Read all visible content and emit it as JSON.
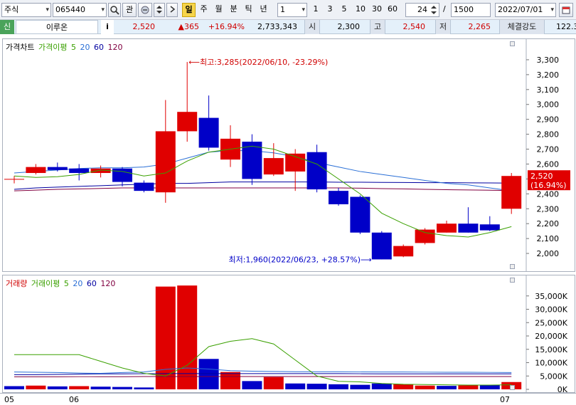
{
  "toolbar": {
    "market_select": "주식",
    "code_input": "065440",
    "search_icon": "magnifier-icon",
    "watch_label": "관",
    "period_buttons": [
      "일",
      "주",
      "월",
      "분",
      "틱",
      "년"
    ],
    "active_period": "일",
    "interval_value": "1",
    "minute_buttons": [
      "1",
      "3",
      "5",
      "10",
      "30",
      "60"
    ],
    "count_value": "24",
    "slash": "/",
    "total_value": "1500",
    "date_value": "2022/07/01"
  },
  "infobar": {
    "tag": "신",
    "stock_name": "이루온",
    "info_label": "i",
    "price": "2,520",
    "change": "▲365",
    "change_pct": "+16.94%",
    "volume": "2,733,343",
    "open_label": "시",
    "open": "2,300",
    "high_label": "고",
    "high": "2,540",
    "low_label": "저",
    "low": "2,265",
    "strength_label": "체결강도",
    "strength": "122.3"
  },
  "price_panel": {
    "legend": {
      "main": "가격차트",
      "ma_label": "가격이평",
      "ma_values": [
        "5",
        "20",
        "60",
        "120"
      ]
    },
    "annotations": {
      "high": "⟵최고:3,285(2022/06/10, -23.29%)",
      "low": "최저:1,960(2022/06/23, +28.57%)⟶"
    },
    "current_label_price": "2,520",
    "current_label_pct": "(16.94%)"
  },
  "volume_panel": {
    "legend": {
      "main": "거래량",
      "ma_label": "거래이평",
      "ma_values": [
        "5",
        "20",
        "60",
        "120"
      ]
    }
  },
  "date_axis": [
    "05",
    "06",
    "07"
  ],
  "colors": {
    "up": "#e00000",
    "down": "#0000c8",
    "ma5": "#3aa000",
    "ma20": "#2a6fd6",
    "ma60": "#0000a0",
    "ma120": "#800040"
  },
  "chart_data": [
    {
      "type": "candlestick",
      "ylim": [
        1900,
        3400
      ],
      "y_ticks": [
        "2,000",
        "2,100",
        "2,200",
        "2,300",
        "2,400",
        "2,500",
        "2,600",
        "2,700",
        "2,800",
        "2,900",
        "3,000",
        "3,100",
        "3,200",
        "3,300"
      ],
      "candles": [
        {
          "o": 2500,
          "h": 2520,
          "l": 2470,
          "c": 2500
        },
        {
          "o": 2540,
          "h": 2600,
          "l": 2530,
          "c": 2580
        },
        {
          "o": 2580,
          "h": 2610,
          "l": 2550,
          "c": 2560
        },
        {
          "o": 2570,
          "h": 2600,
          "l": 2490,
          "c": 2540
        },
        {
          "o": 2540,
          "h": 2590,
          "l": 2510,
          "c": 2570
        },
        {
          "o": 2570,
          "h": 2580,
          "l": 2450,
          "c": 2480
        },
        {
          "o": 2475,
          "h": 2490,
          "l": 2410,
          "c": 2420
        },
        {
          "o": 2410,
          "h": 3030,
          "l": 2340,
          "c": 2820
        },
        {
          "o": 2820,
          "h": 3285,
          "l": 2750,
          "c": 2950
        },
        {
          "o": 2910,
          "h": 3060,
          "l": 2690,
          "c": 2710
        },
        {
          "o": 2630,
          "h": 2860,
          "l": 2580,
          "c": 2770
        },
        {
          "o": 2750,
          "h": 2800,
          "l": 2460,
          "c": 2500
        },
        {
          "o": 2530,
          "h": 2740,
          "l": 2520,
          "c": 2640
        },
        {
          "o": 2550,
          "h": 2700,
          "l": 2420,
          "c": 2670
        },
        {
          "o": 2680,
          "h": 2730,
          "l": 2410,
          "c": 2430
        },
        {
          "o": 2420,
          "h": 2440,
          "l": 2320,
          "c": 2330
        },
        {
          "o": 2380,
          "h": 2390,
          "l": 2130,
          "c": 2140
        },
        {
          "o": 2140,
          "h": 2150,
          "l": 1960,
          "c": 1960
        },
        {
          "o": 1980,
          "h": 2060,
          "l": 1975,
          "c": 2050
        },
        {
          "o": 2070,
          "h": 2170,
          "l": 2060,
          "c": 2160
        },
        {
          "o": 2140,
          "h": 2220,
          "l": 2140,
          "c": 2200
        },
        {
          "o": 2200,
          "h": 2310,
          "l": 2140,
          "c": 2140
        },
        {
          "o": 2195,
          "h": 2250,
          "l": 2150,
          "c": 2155
        },
        {
          "o": 2300,
          "h": 2540,
          "l": 2265,
          "c": 2520
        }
      ],
      "ma5": [
        2520,
        2510,
        2515,
        2530,
        2560,
        2550,
        2520,
        2540,
        2620,
        2680,
        2700,
        2720,
        2700,
        2650,
        2600,
        2500,
        2400,
        2270,
        2200,
        2140,
        2120,
        2110,
        2140,
        2180
      ],
      "ma20": [
        2540,
        2550,
        2560,
        2570,
        2575,
        2575,
        2580,
        2600,
        2640,
        2680,
        2690,
        2690,
        2675,
        2650,
        2610,
        2580,
        2550,
        2530,
        2510,
        2490,
        2470,
        2460,
        2440,
        2420
      ],
      "ma60": [
        2430,
        2440,
        2445,
        2450,
        2455,
        2460,
        2465,
        2470,
        2470,
        2475,
        2480,
        2480,
        2480,
        2480,
        2480,
        2478,
        2478,
        2477,
        2476,
        2475,
        2475,
        2474,
        2473,
        2472
      ],
      "ma120": [
        2420,
        2425,
        2430,
        2433,
        2436,
        2440,
        2440,
        2440,
        2440,
        2440,
        2440,
        2440,
        2440,
        2440,
        2440,
        2440,
        2438,
        2435,
        2433,
        2430,
        2428,
        2426,
        2424,
        2422
      ]
    },
    {
      "type": "bar",
      "title": "거래량",
      "ylim": [
        0,
        40000
      ],
      "y_ticks": [
        "0K",
        "5,000K",
        "10,000K",
        "15,000K",
        "20,000K",
        "25,000K",
        "30,000K",
        "35,000K"
      ],
      "values": [
        1200,
        1400,
        1100,
        1200,
        1000,
        900,
        700,
        38500,
        38900,
        11400,
        6500,
        3100,
        4600,
        2200,
        2100,
        1900,
        1700,
        2200,
        1900,
        1400,
        1300,
        1500,
        1700,
        2733
      ],
      "up": [
        false,
        true,
        false,
        true,
        false,
        false,
        false,
        true,
        true,
        false,
        true,
        false,
        true,
        false,
        false,
        false,
        false,
        false,
        true,
        true,
        false,
        true,
        false,
        true
      ],
      "ma5": [
        13000,
        13000,
        13000,
        13000,
        10500,
        8000,
        6000,
        5000,
        9000,
        16000,
        18000,
        19000,
        17000,
        11000,
        5000,
        3000,
        2800,
        2200,
        1900,
        1800,
        1700,
        1600,
        1600,
        1700
      ],
      "ma20": [
        6500,
        6400,
        6300,
        6100,
        6000,
        6300,
        6500,
        7500,
        8000,
        7600,
        7000,
        6800,
        6700,
        6600,
        6600,
        6600,
        6550,
        6500,
        6500,
        6450,
        6400,
        6400,
        6350,
        6300
      ],
      "ma60": [
        5500,
        5500,
        5600,
        5700,
        5800,
        5800,
        5850,
        5900,
        5900,
        5900,
        5900,
        5900,
        5900,
        5900,
        5900,
        5900,
        5850,
        5800,
        5800,
        5800,
        5800,
        5800,
        5800,
        5800
      ],
      "ma120": [
        4700,
        4700,
        4700,
        4750,
        4750,
        4750,
        4800,
        4800,
        4800,
        4800,
        4800,
        4800,
        4800,
        4800,
        4800,
        4800,
        4800,
        4800,
        4800,
        4800,
        4800,
        4800,
        4800,
        4800
      ]
    }
  ]
}
